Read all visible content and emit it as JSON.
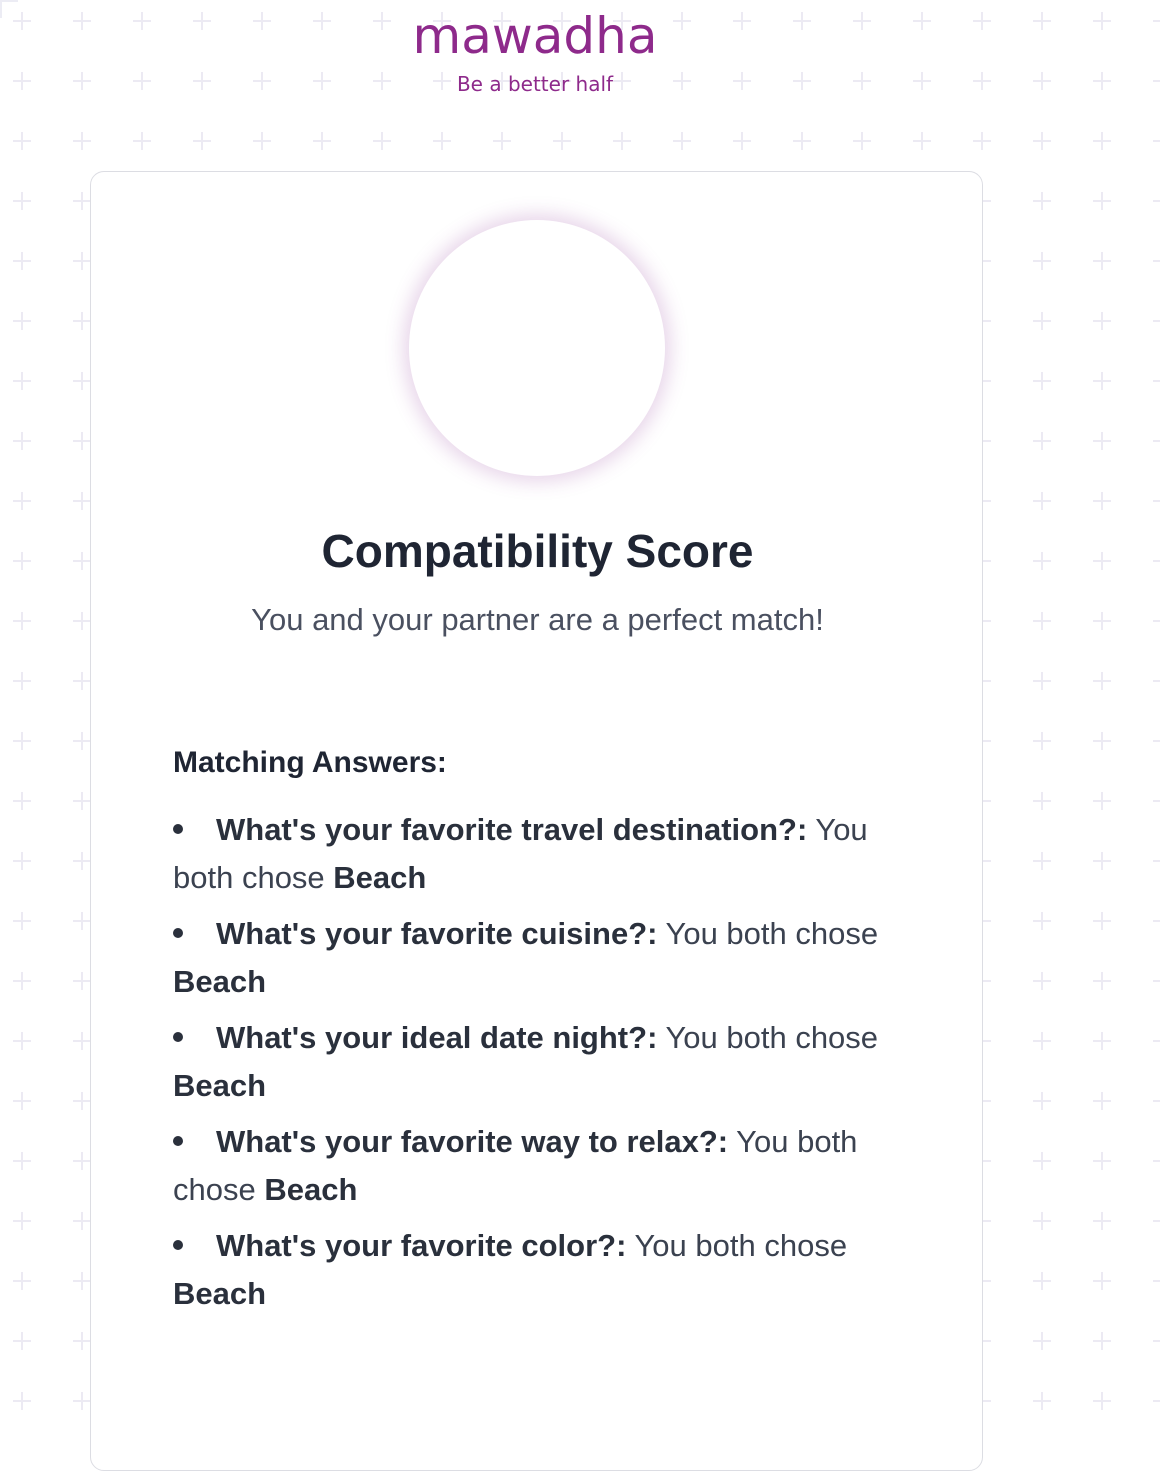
{
  "brand": {
    "name": "mawadha",
    "tagline": "Be a better half",
    "color": "#8e2a8b"
  },
  "result": {
    "title": "Compatibility Score",
    "message": "You and your partner are a perfect match!"
  },
  "answers": {
    "heading": "Matching Answers:",
    "items": [
      {
        "question": "What's your favorite travel destination?:",
        "text": " You both chose ",
        "choice": "Beach"
      },
      {
        "question": "What's your favorite cuisine?:",
        "text": " You both chose ",
        "choice": "Beach"
      },
      {
        "question": "What's your ideal date night?:",
        "text": " You both chose ",
        "choice": "Beach"
      },
      {
        "question": "What's your favorite way to relax?:",
        "text": " You both chose ",
        "choice": "Beach"
      },
      {
        "question": "What's your favorite color?:",
        "text": " You both chose ",
        "choice": "Beach"
      }
    ]
  }
}
